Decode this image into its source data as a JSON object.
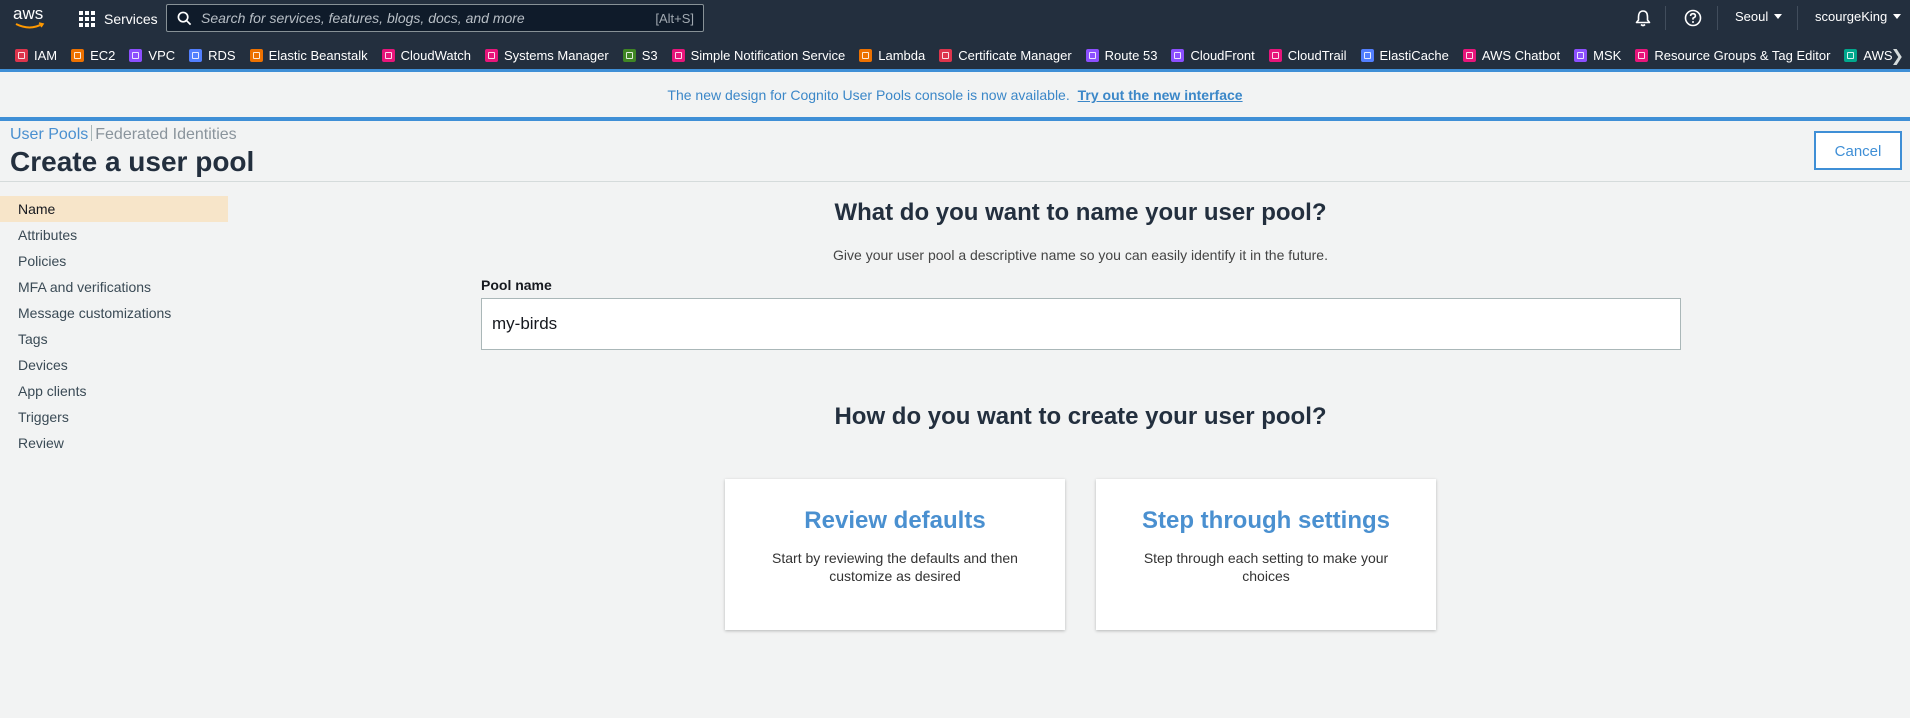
{
  "topnav": {
    "logo_text": "aws",
    "services_label": "Services",
    "search_placeholder": "Search for services, features, blogs, docs, and more",
    "search_shortcut": "[Alt+S]",
    "region": "Seoul",
    "user": "scourgeKing",
    "icons": [
      "bell-icon",
      "help-icon"
    ]
  },
  "favorites": [
    {
      "label": "IAM",
      "color": "#dd344c"
    },
    {
      "label": "EC2",
      "color": "#ed7100"
    },
    {
      "label": "VPC",
      "color": "#8c4fff"
    },
    {
      "label": "RDS",
      "color": "#527fff"
    },
    {
      "label": "Elastic Beanstalk",
      "color": "#ed7100"
    },
    {
      "label": "CloudWatch",
      "color": "#e7157b"
    },
    {
      "label": "Systems Manager",
      "color": "#e7157b"
    },
    {
      "label": "S3",
      "color": "#3f8624"
    },
    {
      "label": "Simple Notification Service",
      "color": "#e7157b"
    },
    {
      "label": "Lambda",
      "color": "#ed7100"
    },
    {
      "label": "Certificate Manager",
      "color": "#dd344c"
    },
    {
      "label": "Route 53",
      "color": "#8c4fff"
    },
    {
      "label": "CloudFront",
      "color": "#8c4fff"
    },
    {
      "label": "CloudTrail",
      "color": "#e7157b"
    },
    {
      "label": "ElastiCache",
      "color": "#527fff"
    },
    {
      "label": "AWS Chatbot",
      "color": "#e7157b"
    },
    {
      "label": "MSK",
      "color": "#8c4fff"
    },
    {
      "label": "Resource Groups & Tag Editor",
      "color": "#e7157b"
    },
    {
      "label": "AWS",
      "color": "#01a88d"
    }
  ],
  "banner": {
    "text": "The new design for Cognito User Pools console is now available.",
    "link": "Try out the new interface"
  },
  "header": {
    "crumb_user_pools": "User Pools",
    "crumb_federated": "Federated Identities",
    "title": "Create a user pool",
    "cancel_label": "Cancel"
  },
  "steps": [
    {
      "label": "Name",
      "active": true
    },
    {
      "label": "Attributes",
      "active": false
    },
    {
      "label": "Policies",
      "active": false
    },
    {
      "label": "MFA and verifications",
      "active": false
    },
    {
      "label": "Message customizations",
      "active": false
    },
    {
      "label": "Tags",
      "active": false
    },
    {
      "label": "Devices",
      "active": false
    },
    {
      "label": "App clients",
      "active": false
    },
    {
      "label": "Triggers",
      "active": false
    },
    {
      "label": "Review",
      "active": false
    }
  ],
  "main": {
    "name_question": "What do you want to name your user pool?",
    "name_help": "Give your user pool a descriptive name so you can easily identify it in the future.",
    "pool_name_label": "Pool name",
    "pool_name_value": "my-birds",
    "create_question": "How do you want to create your user pool?",
    "options": [
      {
        "title": "Review defaults",
        "desc": "Start by reviewing the defaults and then customize as desired"
      },
      {
        "title": "Step through settings",
        "desc": "Step through each setting to make your choices"
      }
    ]
  },
  "colors": {
    "nav_bg": "#232f3e",
    "accent_blue": "#3f8fd6",
    "active_step_bg": "#f7e5c9",
    "link_blue": "#4a90d0"
  }
}
